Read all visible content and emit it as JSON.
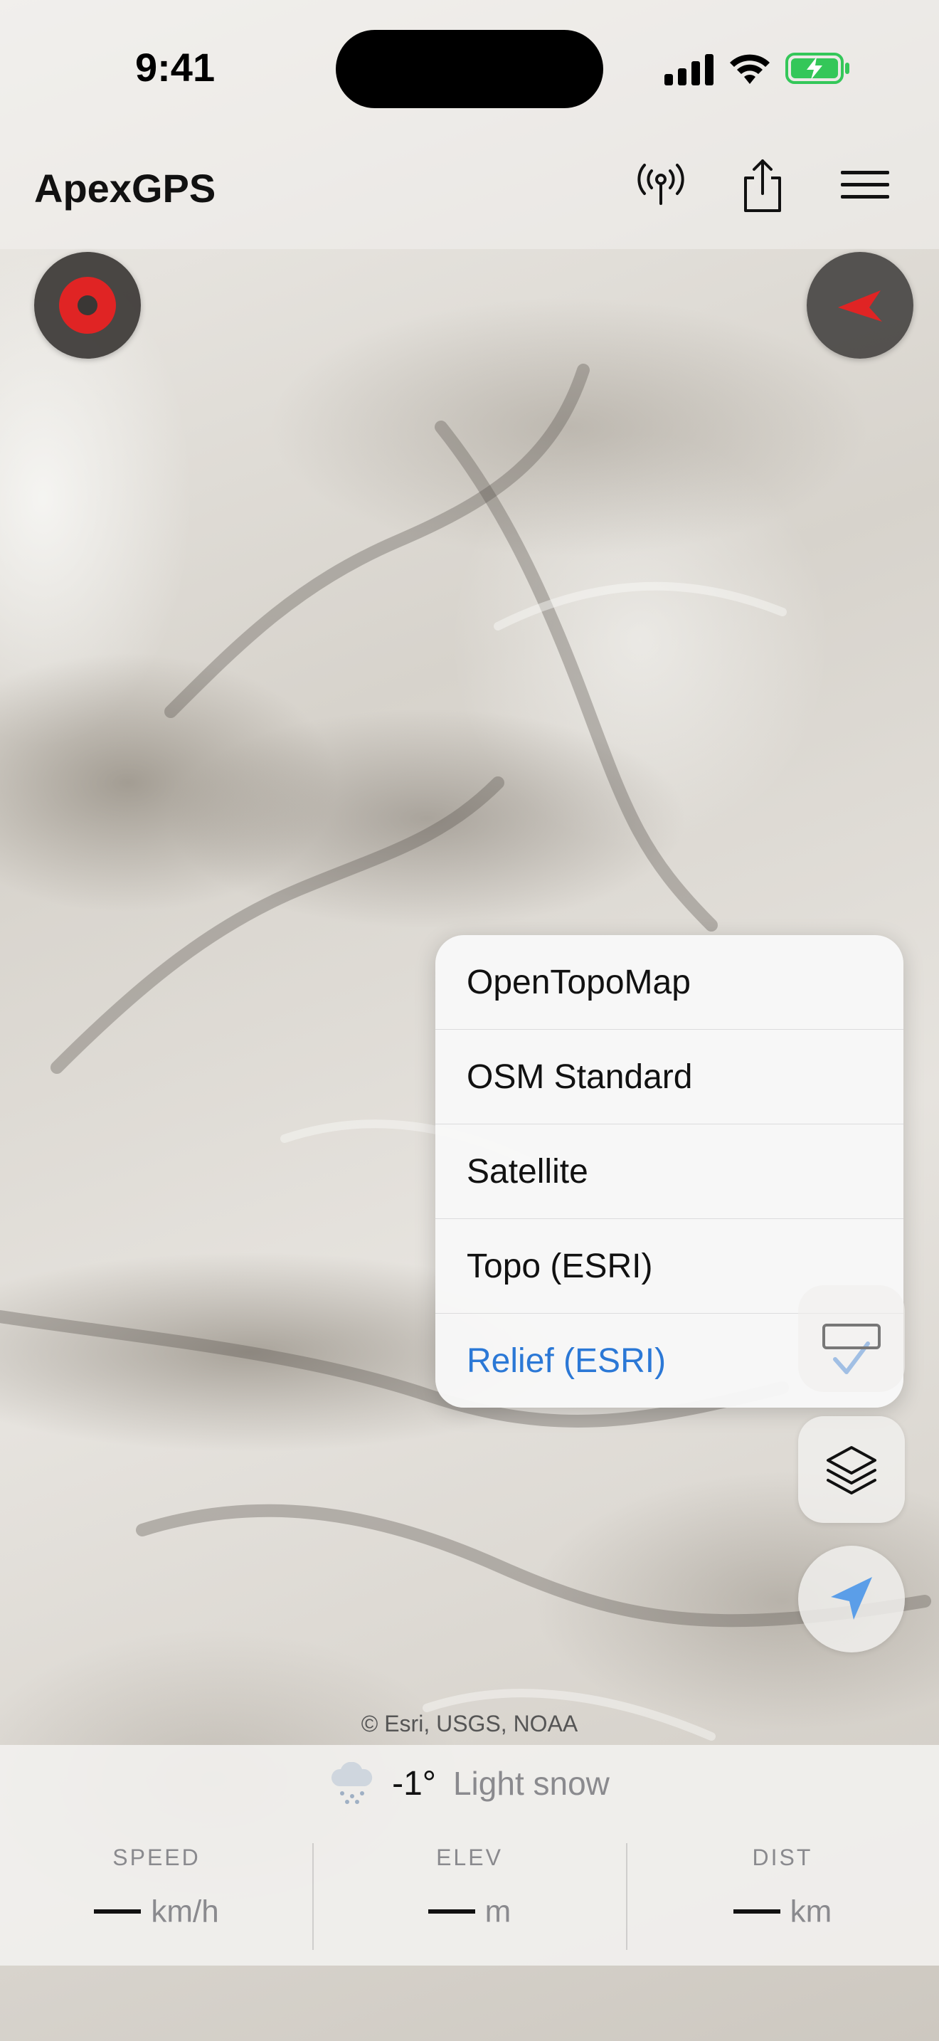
{
  "status_bar": {
    "time": "9:41"
  },
  "header": {
    "app_title": "ApexGPS"
  },
  "map": {
    "attribution": "© Esri, USGS, NOAA",
    "style": "shaded relief"
  },
  "layer_menu": {
    "items": [
      {
        "label": "OpenTopoMap",
        "selected": false
      },
      {
        "label": "OSM Standard",
        "selected": false
      },
      {
        "label": "Satellite",
        "selected": false
      },
      {
        "label": "Topo (ESRI)",
        "selected": false
      },
      {
        "label": "Relief (ESRI)",
        "selected": true
      }
    ],
    "selected_color": "#2b78d6"
  },
  "weather": {
    "icon": "snow-cloud-icon",
    "temperature": "-1°",
    "description": "Light snow"
  },
  "stats": [
    {
      "label": "SPEED",
      "value": "—",
      "unit": "km/h"
    },
    {
      "label": "ELEV",
      "value": "—",
      "unit": "m"
    },
    {
      "label": "DIST",
      "value": "—",
      "unit": "km"
    }
  ],
  "colors": {
    "accent": "#2b78d6",
    "record": "#e02424",
    "battery": "#34c759"
  }
}
